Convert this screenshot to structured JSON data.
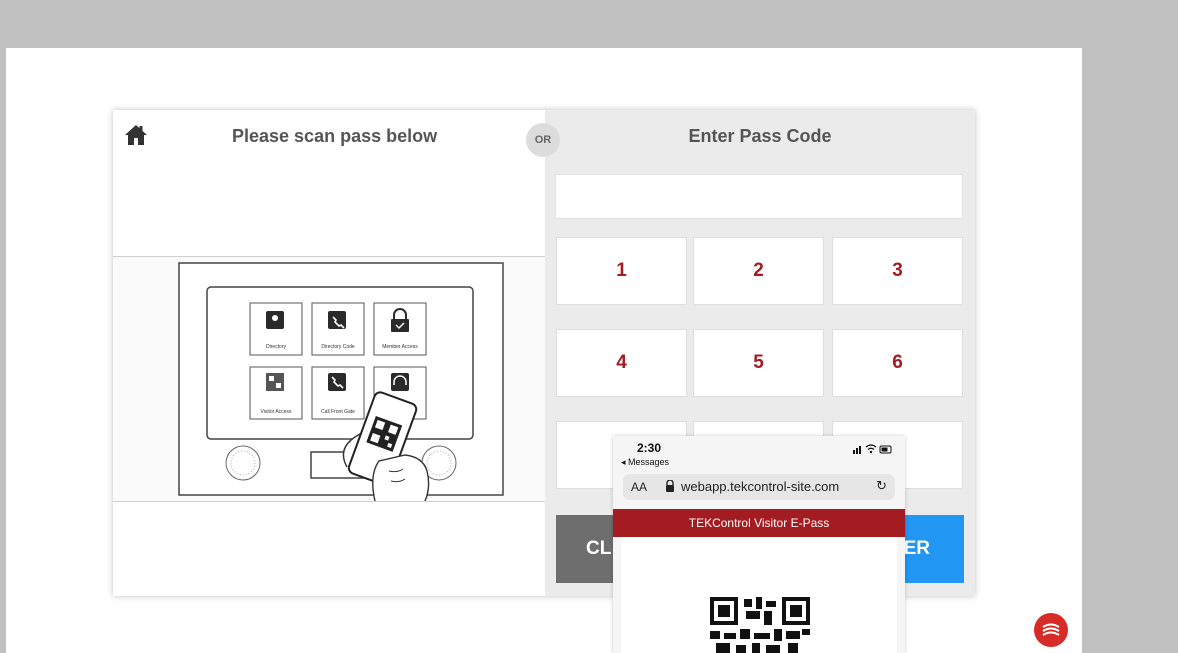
{
  "left_panel": {
    "title": "Please scan pass below",
    "home_icon": "home-icon",
    "kiosk_tiles": [
      {
        "label": "Directory",
        "icon": "address-book-icon"
      },
      {
        "label": "Directory Code",
        "icon": "phone-book-icon"
      },
      {
        "label": "Member Access",
        "icon": "lock-check-icon"
      },
      {
        "label": "Visitor Access",
        "icon": "qr-scan-icon"
      },
      {
        "label": "Call Front Gate",
        "icon": "phone-icon"
      },
      {
        "label": "",
        "icon": "headset-icon"
      }
    ]
  },
  "or_label": "OR",
  "right_panel": {
    "title": "Enter Pass Code",
    "input_value": "",
    "keys": [
      "1",
      "2",
      "3",
      "4",
      "5",
      "6"
    ],
    "clear_label": "CL",
    "enter_label": "ER",
    "accent_color": "#a31c22",
    "enter_color": "#2196f3"
  },
  "phone": {
    "time": "2:30",
    "back_label": "◂ Messages",
    "aa_label": "AA",
    "url": "webapp.tekcontrol-site.com",
    "header": "TEKControl Visitor E-Pass"
  }
}
